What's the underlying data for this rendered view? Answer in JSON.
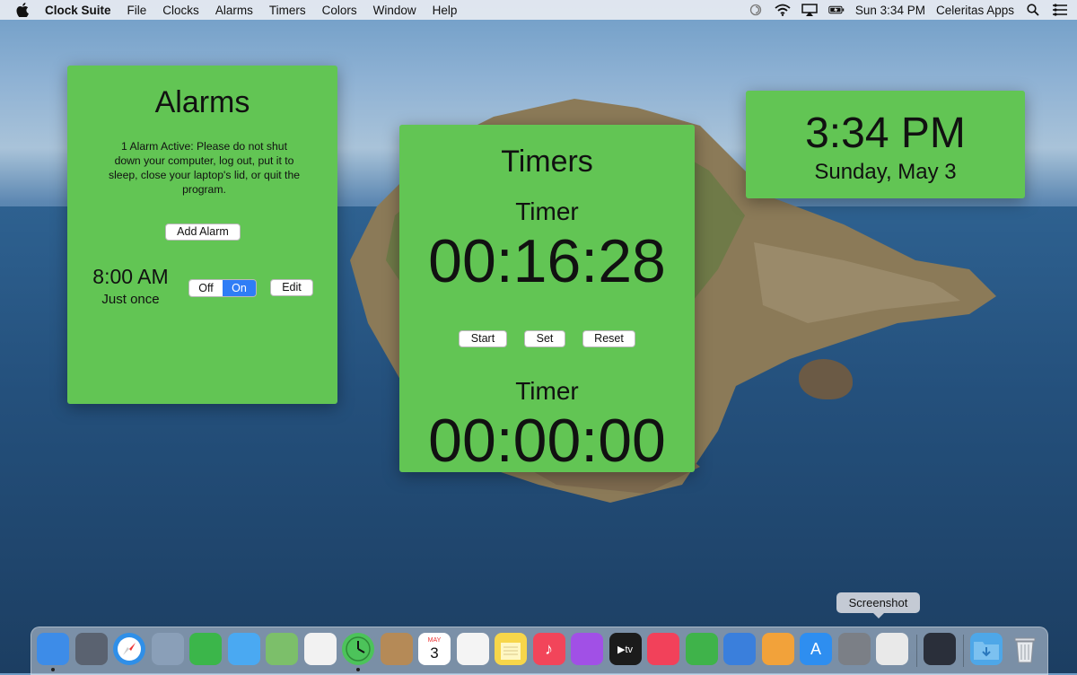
{
  "menubar": {
    "apple_icon": "apple-icon",
    "app_name": "Clock Suite",
    "menus": [
      "File",
      "Clocks",
      "Alarms",
      "Timers",
      "Colors",
      "Window",
      "Help"
    ],
    "status": {
      "clock": "Sun 3:34 PM",
      "user": "Celeritas Apps",
      "icons": [
        "focus-icon",
        "wifi-icon",
        "airplay-icon",
        "battery-icon",
        "search-icon",
        "control-center-icon"
      ]
    }
  },
  "alarms_window": {
    "title": "Alarms",
    "note": "1 Alarm Active: Please do not shut down your computer, log out, put it to sleep, close your laptop's lid, or quit the program.",
    "add_button": "Add Alarm",
    "alarm": {
      "time": "8:00 AM",
      "repeat": "Just once",
      "toggle_off": "Off",
      "toggle_on": "On",
      "toggle_value": "On",
      "edit_button": "Edit"
    }
  },
  "timers_window": {
    "title": "Timers",
    "timer1": {
      "label": "Timer",
      "value": "00:16:28"
    },
    "buttons": {
      "start": "Start",
      "set": "Set",
      "reset": "Reset"
    },
    "timer2": {
      "label": "Timer",
      "value": "00:00:00"
    }
  },
  "clock_window": {
    "time": "3:34 PM",
    "date": "Sunday, May 3"
  },
  "tooltip": "Screenshot",
  "dock": {
    "apps": [
      {
        "name": "finder-icon",
        "color": "#3d8ce8",
        "running": true
      },
      {
        "name": "launchpad-icon",
        "color": "#5a6270",
        "running": false
      },
      {
        "name": "safari-icon",
        "color": "#2f8fe8",
        "running": false
      },
      {
        "name": "mail-icon",
        "color": "#8a9fb8",
        "running": false
      },
      {
        "name": "facetime-icon",
        "color": "#3bb64a",
        "running": false
      },
      {
        "name": "messages-icon",
        "color": "#4aa9f2",
        "running": false
      },
      {
        "name": "maps-icon",
        "color": "#7cbf6a",
        "running": false
      },
      {
        "name": "photos-icon",
        "color": "#f2f2f2",
        "running": false
      },
      {
        "name": "clock-icon",
        "color": "#4cc35a",
        "running": true
      },
      {
        "name": "contacts-icon",
        "color": "#b58a57",
        "running": false
      },
      {
        "name": "calendar-icon",
        "color": "#ffffff",
        "running": false
      },
      {
        "name": "reminders-icon",
        "color": "#f4f4f4",
        "running": false
      },
      {
        "name": "notes-icon",
        "color": "#f7d64a",
        "running": false
      },
      {
        "name": "music-icon",
        "color": "#f2455a",
        "running": false
      },
      {
        "name": "podcasts-icon",
        "color": "#a150e6",
        "running": false
      },
      {
        "name": "tv-icon",
        "color": "#1b1b1b",
        "running": false
      },
      {
        "name": "news-icon",
        "color": "#f2415a",
        "running": false
      },
      {
        "name": "numbers-icon",
        "color": "#3fb34a",
        "running": false
      },
      {
        "name": "keynote-icon",
        "color": "#3a7fdc",
        "running": false
      },
      {
        "name": "pages-icon",
        "color": "#f2a23a",
        "running": false
      },
      {
        "name": "app-store-icon",
        "color": "#2e8ef0",
        "running": false
      },
      {
        "name": "system-preferences-icon",
        "color": "#7b7f86",
        "running": false
      },
      {
        "name": "screenshot-icon",
        "color": "#e9e9e9",
        "running": false
      },
      {
        "name": "quicktime-icon",
        "color": "#2a2f3a",
        "running": false
      },
      {
        "name": "downloads-folder-icon",
        "color": "#4ea7e8",
        "running": false
      },
      {
        "name": "trash-icon",
        "color": "#c7cdd6",
        "running": false
      }
    ],
    "calendar_month": "MAY",
    "calendar_day": "3"
  }
}
